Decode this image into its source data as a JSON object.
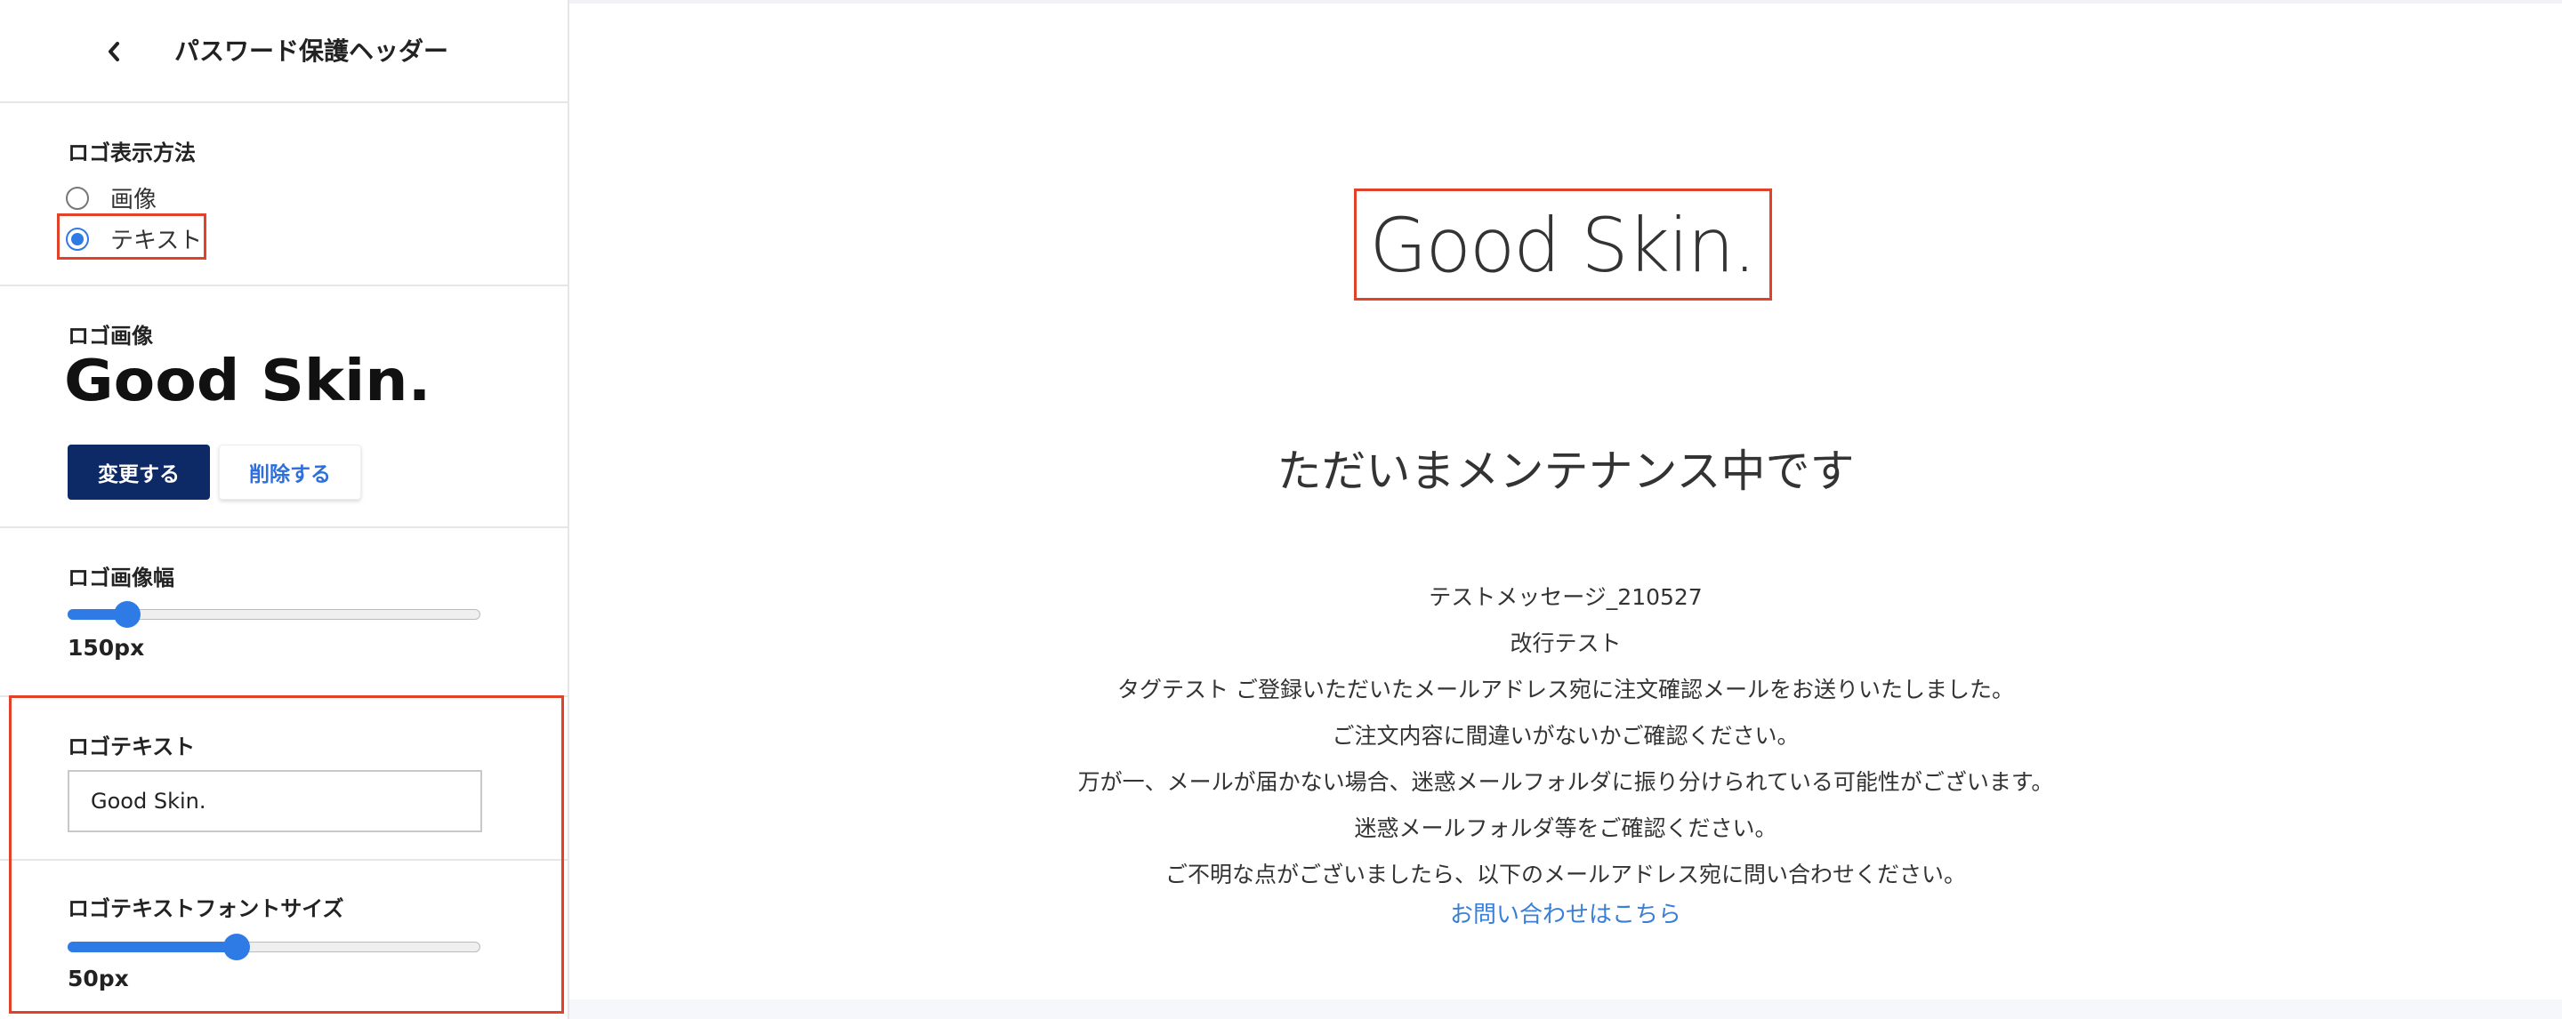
{
  "sidebar": {
    "title": "パスワード保護ヘッダー",
    "display_method": {
      "label": "ロゴ表示方法",
      "options": [
        {
          "label": "画像",
          "checked": false
        },
        {
          "label": "テキスト",
          "checked": true
        }
      ]
    },
    "logo_image": {
      "label": "ロゴ画像",
      "logo_text": "Good Skin.",
      "change_label": "変更する",
      "delete_label": "削除する"
    },
    "logo_width": {
      "label": "ロゴ画像幅",
      "value_text": "150px",
      "fraction": 0.145
    },
    "logo_text_field": {
      "label": "ロゴテキスト",
      "value": "Good Skin."
    },
    "logo_font_size": {
      "label": "ロゴテキストフォントサイズ",
      "value_text": "50px",
      "fraction": 0.41
    }
  },
  "preview": {
    "logo_text": "Good Skin.",
    "heading": "ただいまメンテナンス中です",
    "message_lines": [
      "テストメッセージ_210527",
      "改行テスト",
      "タグテスト ご登録いただいたメールアドレス宛に注文確認メールをお送りいたしました。",
      "ご注文内容に間違いがないかご確認ください。",
      "万が一、メールが届かない場合、迷惑メールフォルダに振り分けられている可能性がございます。",
      "迷惑メールフォルダ等をご確認ください。",
      "ご不明な点がございましたら、以下のメールアドレス宛に問い合わせください。"
    ],
    "contact_link": "お問い合わせはこちら"
  },
  "colors": {
    "accent": "#2f7be5",
    "primary_button": "#0e2a66",
    "highlight": "#e0432a",
    "link": "#3a7fd4"
  }
}
